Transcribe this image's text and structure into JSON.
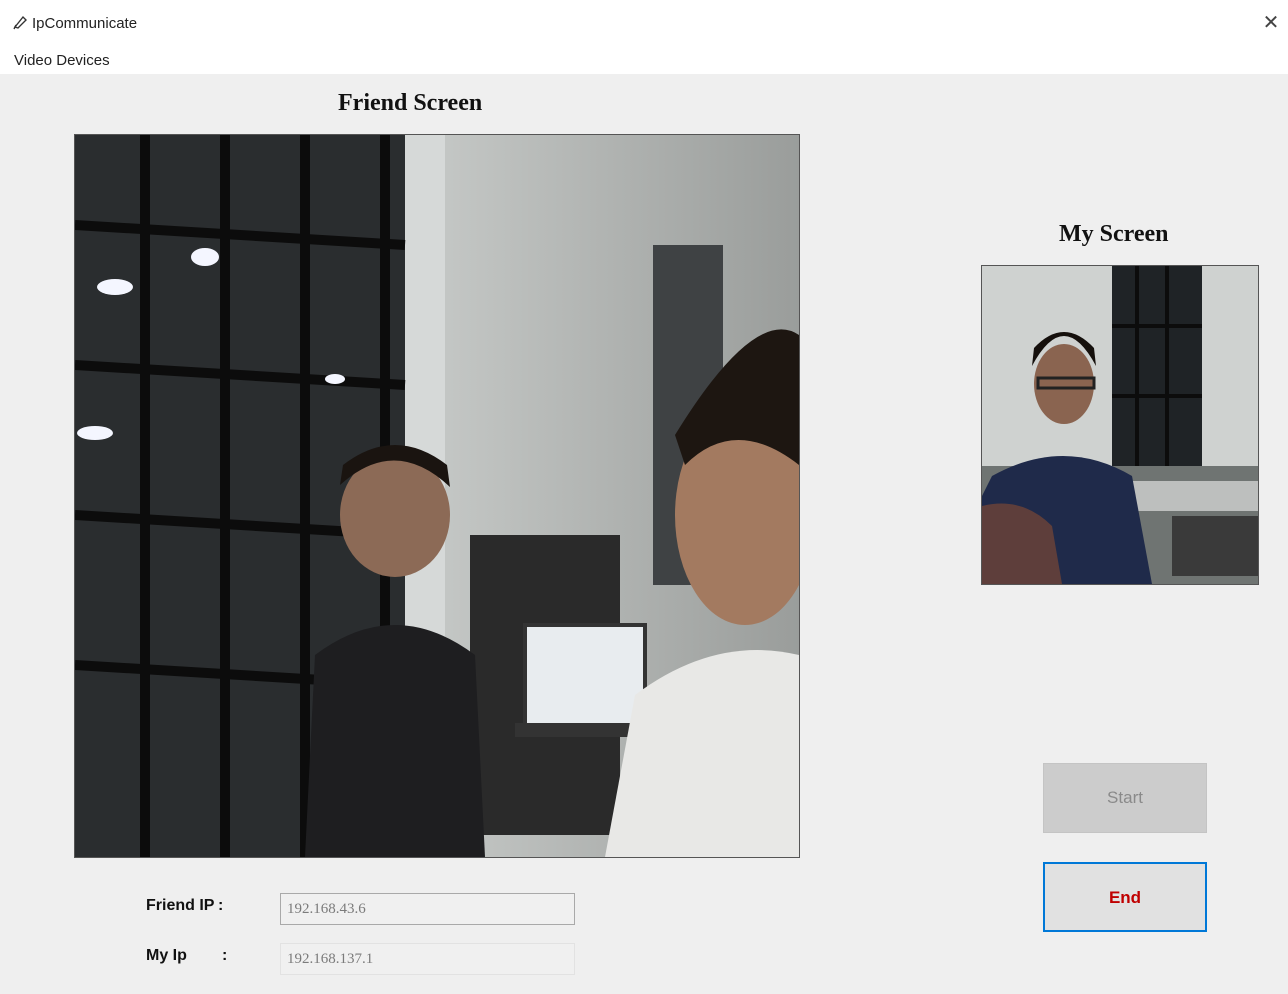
{
  "window": {
    "title": "IpCommunicate",
    "close_glyph": "✕"
  },
  "menu": {
    "items": [
      "Video Devices"
    ]
  },
  "friend_screen": {
    "heading": "Friend Screen"
  },
  "my_screen": {
    "heading": "My Screen"
  },
  "friend_ip": {
    "label": "Friend IP",
    "colon": ":",
    "value": "192.168.43.6"
  },
  "my_ip": {
    "label": "My Ip",
    "colon": ":",
    "value": "192.168.137.1"
  },
  "buttons": {
    "start": "Start",
    "end": "End"
  },
  "colors": {
    "end_button_border": "#0078d7",
    "end_button_text": "#c00000",
    "disabled_button_bg": "#cccccc"
  }
}
